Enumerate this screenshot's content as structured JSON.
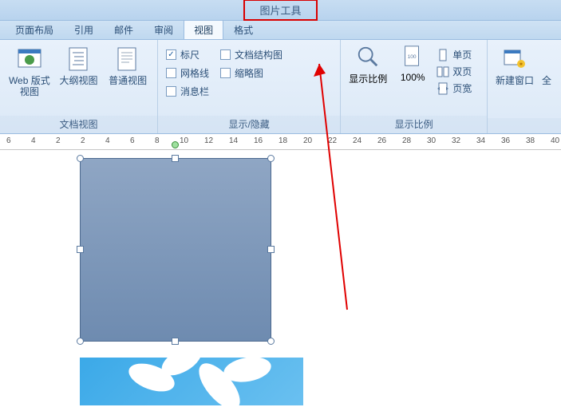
{
  "title_tool": "图片工具",
  "tabs": [
    {
      "label": "页面布局"
    },
    {
      "label": "引用"
    },
    {
      "label": "邮件"
    },
    {
      "label": "审阅"
    },
    {
      "label": "视图",
      "active": true
    },
    {
      "label": "格式"
    }
  ],
  "group_views": {
    "label": "文档视图",
    "items": [
      {
        "label": "Web 版式视图"
      },
      {
        "label": "大纲视图"
      },
      {
        "label": "普通视图"
      }
    ]
  },
  "group_show": {
    "label": "显示/隐藏",
    "col1": [
      {
        "label": "标尺",
        "checked": true
      },
      {
        "label": "网格线",
        "checked": false
      },
      {
        "label": "消息栏",
        "checked": false
      }
    ],
    "col2": [
      {
        "label": "文档结构图",
        "checked": false
      },
      {
        "label": "缩略图",
        "checked": false
      }
    ]
  },
  "group_zoom": {
    "label": "显示比例",
    "zoom_btn": "显示比例",
    "pct_btn": "100%",
    "pages": [
      {
        "label": "单页"
      },
      {
        "label": "双页"
      },
      {
        "label": "页宽"
      }
    ]
  },
  "group_window": {
    "new_win": "新建窗口",
    "all": "全"
  },
  "ruler_numbers": [
    6,
    4,
    2,
    2,
    4,
    6,
    8,
    10,
    12,
    14,
    16,
    18,
    20,
    22,
    24,
    26,
    28,
    30,
    32,
    34,
    36,
    38,
    40
  ]
}
